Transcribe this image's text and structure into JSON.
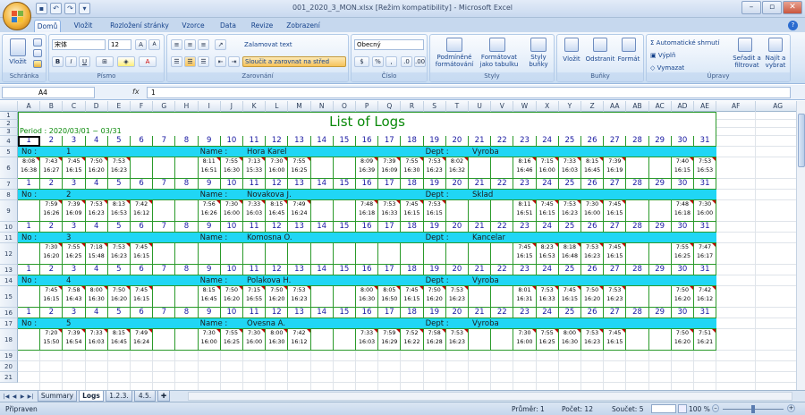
{
  "window": {
    "title": "001_2020_3_MON.xlsx  [Režim kompatibility]  -  Microsoft Excel"
  },
  "ribbon_tabs": [
    "Domů",
    "Vložit",
    "Rozložení stránky",
    "Vzorce",
    "Data",
    "Revize",
    "Zobrazení"
  ],
  "ribbon": {
    "clipboard": {
      "paste": "Vložit",
      "label": "Schránka"
    },
    "font": {
      "family": "宋体",
      "size": "12",
      "label": "Písmo"
    },
    "alignment": {
      "wrap": "Zalamovat text",
      "merge": "Sloučit a zarovnat na střed",
      "label": "Zarovnání"
    },
    "number": {
      "format": "Obecný",
      "label": "Číslo"
    },
    "styles": {
      "cond": "Podmíněné formátování",
      "table": "Formátovat jako tabulku",
      "cell": "Styly buňky",
      "label": "Styly"
    },
    "cells": {
      "insert": "Vložit",
      "delete": "Odstranit",
      "format": "Formát",
      "label": "Buňky"
    },
    "editing": {
      "autosum": "Automatické shrnutí",
      "fill": "Výplň",
      "clear": "Vymazat",
      "sort": "Seřadit a filtrovat",
      "find": "Najít a vybrat",
      "label": "Úpravy"
    }
  },
  "formula_bar": {
    "name_box": "A4",
    "fx": "fx",
    "value": "1"
  },
  "columns": [
    "A",
    "B",
    "C",
    "D",
    "E",
    "F",
    "G",
    "H",
    "I",
    "J",
    "K",
    "L",
    "M",
    "N",
    "O",
    "P",
    "Q",
    "R",
    "S",
    "T",
    "U",
    "V",
    "W",
    "X",
    "Y",
    "Z",
    "AA",
    "AB",
    "AC",
    "AD",
    "AE",
    "AF",
    "AG"
  ],
  "rows": [
    "1",
    "2",
    "3",
    "4",
    "5",
    "6",
    "7",
    "8",
    "9",
    "10",
    "11",
    "12",
    "13",
    "14",
    "15",
    "16",
    "17",
    "18",
    "19",
    "20",
    "21"
  ],
  "sheet": {
    "title": "List of Logs",
    "period": "Period :      2020/03/01 ~ 03/31",
    "days": [
      "1",
      "2",
      "3",
      "4",
      "5",
      "6",
      "7",
      "8",
      "9",
      "10",
      "11",
      "12",
      "13",
      "14",
      "15",
      "16",
      "17",
      "18",
      "19",
      "20",
      "21",
      "22",
      "23",
      "24",
      "25",
      "26",
      "27",
      "28",
      "29",
      "30",
      "31"
    ],
    "no_label": "No :",
    "name_label": "Name :",
    "dept_label": "Dept :",
    "employees": [
      {
        "no": "1",
        "name": "Hora Karel",
        "dept": "Vyroba",
        "logs": {
          "1": [
            "8:08",
            "16:38"
          ],
          "2": [
            "7:43",
            "16:27"
          ],
          "3": [
            "7:45",
            "16:15"
          ],
          "4": [
            "7:50",
            "16:20"
          ],
          "5": [
            "7:53",
            "16:23"
          ],
          "9": [
            "8:11",
            "16:51"
          ],
          "10": [
            "7:55",
            "16:30"
          ],
          "11": [
            "7:13",
            "15:33"
          ],
          "12": [
            "7:30",
            "16:00"
          ],
          "13": [
            "7:55",
            "16:25"
          ],
          "16": [
            "8:09",
            "16:39"
          ],
          "17": [
            "7:39",
            "16:09"
          ],
          "18": [
            "7:55",
            "16:30"
          ],
          "19": [
            "7:53",
            "16:23"
          ],
          "20": [
            "8:02",
            "16:32"
          ],
          "23": [
            "8:16",
            "16:46"
          ],
          "24": [
            "7:15",
            "16:00"
          ],
          "25": [
            "7:33",
            "16:03"
          ],
          "26": [
            "8:15",
            "16:45"
          ],
          "27": [
            "7:39",
            "16:19"
          ],
          "30": [
            "7:40",
            "16:15"
          ],
          "31": [
            "7:53",
            "16:53"
          ]
        }
      },
      {
        "no": "2",
        "name": "Novakova J.",
        "dept": "Sklad",
        "logs": {
          "2": [
            "7:59",
            "16:26"
          ],
          "3": [
            "7:39",
            "16:09"
          ],
          "4": [
            "7:53",
            "16:23"
          ],
          "5": [
            "8:13",
            "16:53"
          ],
          "6": [
            "7:42",
            "16:12"
          ],
          "9": [
            "7:56",
            "16:26"
          ],
          "10": [
            "7:30",
            "16:00"
          ],
          "11": [
            "7:33",
            "16:03"
          ],
          "12": [
            "8:15",
            "16:45"
          ],
          "13": [
            "7:49",
            "16:24"
          ],
          "16": [
            "7:48",
            "16:18"
          ],
          "17": [
            "7:53",
            "16:33"
          ],
          "18": [
            "7:45",
            "16:15"
          ],
          "19": [
            "7:53",
            "16:15"
          ],
          "23": [
            "8:11",
            "16:51"
          ],
          "24": [
            "7:45",
            "16:15"
          ],
          "25": [
            "7:53",
            "16:23"
          ],
          "26": [
            "7:30",
            "16:00"
          ],
          "27": [
            "7:45",
            "16:15"
          ],
          "30": [
            "7:48",
            "16:18"
          ],
          "31": [
            "7:30",
            "16:00"
          ]
        }
      },
      {
        "no": "3",
        "name": "Komosna O.",
        "dept": "Kancelar",
        "logs": {
          "2": [
            "7:30",
            "16:20"
          ],
          "3": [
            "7:55",
            "16:25"
          ],
          "4": [
            "7:18",
            "15:48"
          ],
          "5": [
            "7:53",
            "16:23"
          ],
          "6": [
            "7:45",
            "16:15"
          ],
          "23": [
            "7:45",
            "16:15"
          ],
          "24": [
            "8:23",
            "16:53"
          ],
          "25": [
            "8:18",
            "16:48"
          ],
          "26": [
            "7:53",
            "16:23"
          ],
          "27": [
            "7:45",
            "16:15"
          ],
          "30": [
            "7:55",
            "16:25"
          ],
          "31": [
            "7:47",
            "16:17"
          ]
        }
      },
      {
        "no": "4",
        "name": "Polakova H.",
        "dept": "Vyroba",
        "logs": {
          "2": [
            "7:45",
            "16:15"
          ],
          "3": [
            "7:58",
            "16:43"
          ],
          "4": [
            "8:00",
            "16:30"
          ],
          "5": [
            "7:50",
            "16:20"
          ],
          "6": [
            "7:45",
            "16:15"
          ],
          "9": [
            "8:15",
            "16:45"
          ],
          "10": [
            "7:50",
            "16:20"
          ],
          "11": [
            "7:15",
            "16:55"
          ],
          "12": [
            "7:50",
            "16:20"
          ],
          "13": [
            "7:53",
            "16:23"
          ],
          "16": [
            "8:00",
            "16:30"
          ],
          "17": [
            "8:05",
            "16:50"
          ],
          "18": [
            "7:45",
            "16:15"
          ],
          "19": [
            "7:50",
            "16:20"
          ],
          "20": [
            "7:53",
            "16:23"
          ],
          "23": [
            "8:01",
            "16:31"
          ],
          "24": [
            "7:53",
            "16:33"
          ],
          "25": [
            "7:45",
            "16:15"
          ],
          "26": [
            "7:50",
            "16:20"
          ],
          "27": [
            "7:53",
            "16:23"
          ],
          "30": [
            "7:50",
            "16:20"
          ],
          "31": [
            "7:42",
            "16:12"
          ]
        }
      },
      {
        "no": "5",
        "name": "Ovesna A.",
        "dept": "Vyroba",
        "logs": {
          "2": [
            "7:20",
            "15:50"
          ],
          "3": [
            "7:39",
            "16:54"
          ],
          "4": [
            "7:33",
            "16:03"
          ],
          "5": [
            "8:15",
            "16:45"
          ],
          "6": [
            "7:49",
            "16:24"
          ],
          "9": [
            "7:30",
            "16:00"
          ],
          "10": [
            "7:55",
            "16:25"
          ],
          "11": [
            "7:30",
            "16:00"
          ],
          "12": [
            "8:00",
            "16:30"
          ],
          "13": [
            "7:42",
            "16:12"
          ],
          "16": [
            "7:33",
            "16:03"
          ],
          "17": [
            "7:59",
            "16:29"
          ],
          "18": [
            "7:52",
            "16:22"
          ],
          "19": [
            "7:58",
            "16:28"
          ],
          "20": [
            "7:53",
            "16:23"
          ],
          "23": [
            "7:30",
            "16:00"
          ],
          "24": [
            "7:55",
            "16:25"
          ],
          "25": [
            "8:00",
            "16:30"
          ],
          "26": [
            "7:53",
            "16:23"
          ],
          "27": [
            "7:45",
            "16:15"
          ],
          "30": [
            "7:50",
            "16:20"
          ],
          "31": [
            "7:51",
            "16:21"
          ]
        }
      }
    ]
  },
  "sheet_tabs": [
    "Summary",
    "Logs",
    "1.2.3.",
    "4.5."
  ],
  "active_sheet": "Logs",
  "status": {
    "ready": "Připraven",
    "average": "Průměr: 1",
    "count": "Počet: 12",
    "sum": "Součet: 5",
    "zoom": "100 %"
  }
}
